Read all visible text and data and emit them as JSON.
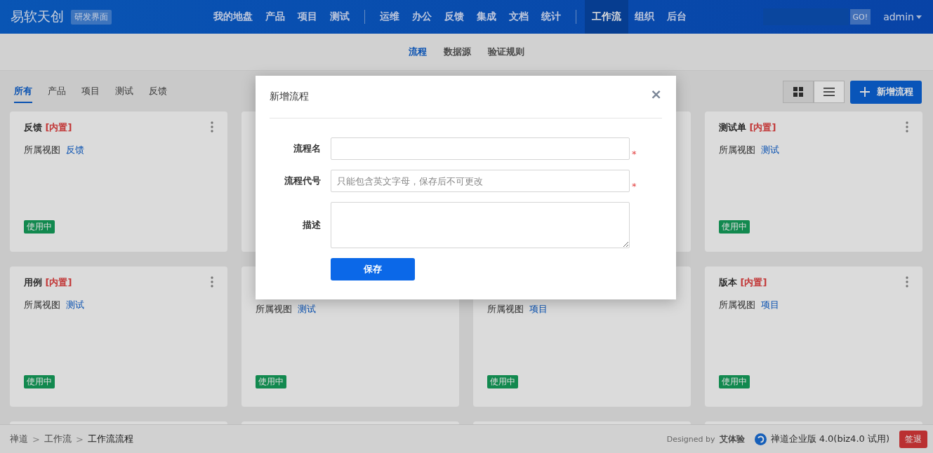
{
  "header": {
    "brand": "易软天创",
    "badge": "研发界面",
    "nav_groups": [
      [
        {
          "label": "我的地盘",
          "selected": false
        },
        {
          "label": "产品",
          "selected": false
        },
        {
          "label": "项目",
          "selected": false
        },
        {
          "label": "测试",
          "selected": false
        }
      ],
      [
        {
          "label": "运维",
          "selected": false
        },
        {
          "label": "办公",
          "selected": false
        },
        {
          "label": "反馈",
          "selected": false
        },
        {
          "label": "集成",
          "selected": false
        },
        {
          "label": "文档",
          "selected": false
        },
        {
          "label": "统计",
          "selected": false
        }
      ],
      [
        {
          "label": "工作流",
          "selected": true
        },
        {
          "label": "组织",
          "selected": false
        },
        {
          "label": "后台",
          "selected": false
        }
      ]
    ],
    "search_button": "GO!",
    "user": "admin"
  },
  "subnav": [
    {
      "label": "流程",
      "selected": true
    },
    {
      "label": "数据源",
      "selected": false
    },
    {
      "label": "验证规则",
      "selected": false
    }
  ],
  "filters": [
    {
      "label": "所有",
      "selected": true
    },
    {
      "label": "产品",
      "selected": false
    },
    {
      "label": "项目",
      "selected": false
    },
    {
      "label": "测试",
      "selected": false
    },
    {
      "label": "反馈",
      "selected": false
    }
  ],
  "view_toggle": [
    {
      "kind": "grid",
      "selected": true
    },
    {
      "kind": "list",
      "selected": false
    }
  ],
  "add_button": "新增流程",
  "cards": [
    {
      "kind": "full",
      "title": "反馈",
      "tag": "[内置]",
      "view_label": "所属视图",
      "view": "反馈",
      "status": "使用中"
    },
    {
      "kind": "hidden"
    },
    {
      "kind": "hidden"
    },
    {
      "kind": "full",
      "title": "测试单",
      "tag": "[内置]",
      "view_label": "所属视图",
      "view": "测试",
      "status": "使用中"
    },
    {
      "kind": "full",
      "title": "用例",
      "tag": "[内置]",
      "view_label": "所属视图",
      "view": "测试",
      "status": "使用中"
    },
    {
      "kind": "covered",
      "view_label": "所属视图",
      "view": "测试",
      "status": "使用中"
    },
    {
      "kind": "covered",
      "view_label": "所属视图",
      "view": "项目",
      "status": "使用中"
    },
    {
      "kind": "full",
      "title": "版本",
      "tag": "[内置]",
      "view_label": "所属视图",
      "view": "项目",
      "status": "使用中"
    },
    {
      "kind": "stub"
    },
    {
      "kind": "stub"
    },
    {
      "kind": "stub"
    },
    {
      "kind": "stub"
    }
  ],
  "footer": {
    "breadcrumbs": [
      {
        "label": "禅道",
        "separator": ">"
      },
      {
        "label": "工作流",
        "separator": ">"
      },
      {
        "label": "工作流流程"
      }
    ],
    "designed_by": "Designed by",
    "designer": "艾体验",
    "version": "禅道企业版 4.0(biz4.0 试用)",
    "logout": "签退"
  },
  "dialog": {
    "title": "新增流程",
    "close": "×",
    "fields": [
      {
        "kind": "input",
        "label": "流程名",
        "required_mark": "*"
      },
      {
        "kind": "input",
        "label": "流程代号",
        "placeholder": "只能包含英文字母，保存后不可更改",
        "required_mark": "*"
      },
      {
        "kind": "textarea",
        "label": "描述"
      }
    ],
    "save": "保存"
  }
}
